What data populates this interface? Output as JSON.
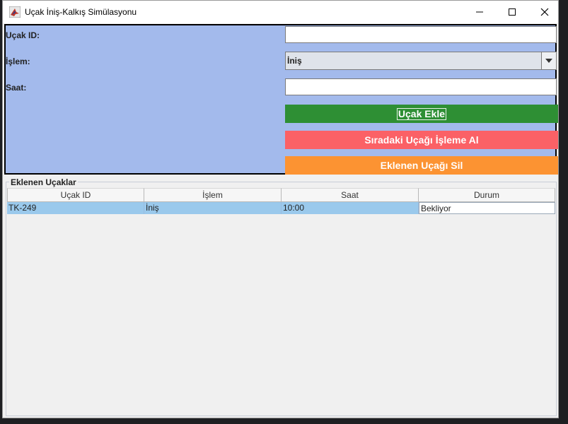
{
  "window": {
    "title": "Uçak İniş-Kalkış Simülasyonu",
    "icon": "airplane-app-icon"
  },
  "form": {
    "labels": {
      "plane_id": "Uçak ID:",
      "operation": "İşlem:",
      "time": "Saat:"
    },
    "fields": {
      "plane_id_value": "",
      "time_value": ""
    },
    "operation_selected": "İniş",
    "buttons": {
      "add": "Uçak Ekle",
      "process_next": "Sıradaki Uçağı İşleme Al",
      "delete": "Eklenen Uçağı Sil"
    }
  },
  "table_group": {
    "title": "Eklenen Uçaklar",
    "columns": [
      "Uçak ID",
      "İşlem",
      "Saat",
      "Durum"
    ],
    "rows": [
      [
        "TK-249",
        "İniş",
        "10:00",
        "Bekliyor"
      ]
    ]
  },
  "colors": {
    "form_bg": "#a3baec",
    "add_button": "#2e8f34",
    "process_button": "#fb6166",
    "delete_button": "#fc9332",
    "selected_row": "#9ac9ec"
  }
}
